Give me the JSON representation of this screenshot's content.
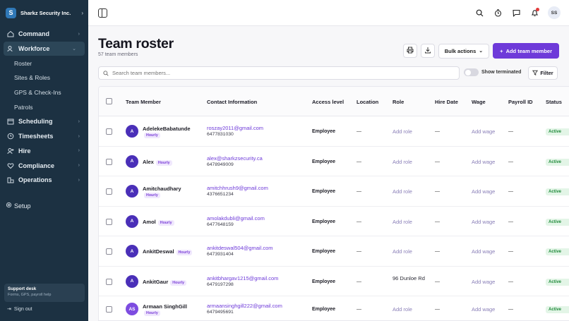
{
  "sidebar": {
    "brand_initial": "S",
    "brand_name": "Sharkz Security Inc.",
    "nav": [
      {
        "label": "Command",
        "icon": "home-icon"
      },
      {
        "label": "Workforce",
        "icon": "users-icon"
      },
      {
        "label": "Scheduling",
        "icon": "calendar-icon"
      },
      {
        "label": "Timesheets",
        "icon": "clock-icon"
      },
      {
        "label": "Hire",
        "icon": "user-plus-icon"
      },
      {
        "label": "Compliance",
        "icon": "heart-icon"
      },
      {
        "label": "Operations",
        "icon": "buildings-icon"
      }
    ],
    "workforce_sub": [
      "Roster",
      "Sites & Roles",
      "GPS & Check-Ins",
      "Patrols"
    ],
    "setup": "Setup",
    "support_title": "Support desk",
    "support_sub": "Forms, GPS, payroll help",
    "sign_out": "Sign out"
  },
  "topbar": {
    "avatar_initials": "SS"
  },
  "header": {
    "title": "Team roster",
    "subtitle": "57 team members",
    "bulk_actions": "Bulk actions",
    "add_member": "Add team member"
  },
  "search": {
    "placeholder": "Search team members..."
  },
  "show_terminated": "Show terminated",
  "filter": "Filter",
  "table": {
    "columns": [
      "Team Member",
      "Contact Information",
      "Access level",
      "Location",
      "Role",
      "Hire Date",
      "Wage",
      "Payroll ID",
      "Status"
    ],
    "rows": [
      {
        "initials": "A",
        "name": "AdelekeBabatunde",
        "badge": "Hourly",
        "email": "roszay2011@gmail.com",
        "phone": "6477831030",
        "access": "Employee",
        "location": "—",
        "role": "Add role",
        "hire": "—",
        "wage": "Add wage",
        "payroll": "—",
        "status": "Active"
      },
      {
        "initials": "A",
        "name": "Alex",
        "badge": "Hourly",
        "email": "alex@sharkzsecurity.ca",
        "phone": "6478949009",
        "access": "Employee",
        "location": "—",
        "role": "Add role",
        "hire": "—",
        "wage": "Add wage",
        "payroll": "—",
        "status": "Active"
      },
      {
        "initials": "A",
        "name": "Amitchaudhary",
        "badge": "Hourly",
        "email": "amitchhrush9@gmail.com",
        "phone": "4376651234",
        "access": "Employee",
        "location": "—",
        "role": "Add role",
        "hire": "—",
        "wage": "Add wage",
        "payroll": "—",
        "status": "Active"
      },
      {
        "initials": "A",
        "name": "Amol",
        "badge": "Hourly",
        "email": "amolakdubli@gmail.com",
        "phone": "6477648159",
        "access": "Employee",
        "location": "—",
        "role": "Add role",
        "hire": "—",
        "wage": "Add wage",
        "payroll": "—",
        "status": "Active"
      },
      {
        "initials": "A",
        "name": "AnkitDeswal",
        "badge": "Hourly",
        "email": "ankitdeswal504@gmail.com",
        "phone": "6473931404",
        "access": "Employee",
        "location": "—",
        "role": "Add role",
        "hire": "—",
        "wage": "Add wage",
        "payroll": "—",
        "status": "Active"
      },
      {
        "initials": "A",
        "name": "AnkitGaur",
        "badge": "Hourly",
        "email": "ankitbhargav1215@gmail.com",
        "phone": "6479197298",
        "access": "Employee",
        "location": "—",
        "role": "96 Dunloe Rd",
        "hire": "—",
        "wage": "Add wage",
        "payroll": "—",
        "status": "Active"
      },
      {
        "initials": "AS",
        "name": "Armaan SinghGill",
        "badge": "Hourly",
        "email": "armaansinghgill222@gmail.com",
        "phone": "6479495691",
        "access": "Employee",
        "location": "—",
        "role": "Add role",
        "hire": "—",
        "wage": "Add wage",
        "payroll": "—",
        "status": "Active"
      }
    ]
  },
  "colors": {
    "sidebar_bg": "#1c3142",
    "accent": "#6e3ad9",
    "avatar": "#4a2fb8",
    "avatar_alt": "#7d4ce0",
    "status_green": "#1f8a3a"
  }
}
